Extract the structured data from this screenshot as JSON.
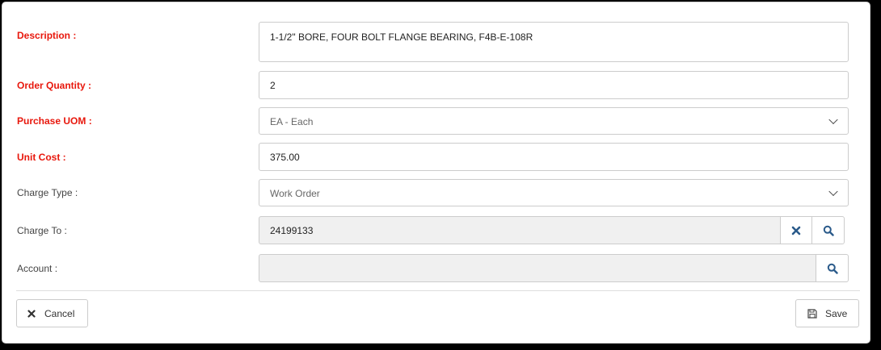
{
  "form": {
    "description": {
      "label": "Description :",
      "value": "1-1/2\" BORE, FOUR BOLT FLANGE BEARING, F4B-E-108R"
    },
    "order_quantity": {
      "label": "Order Quantity :",
      "value": "2"
    },
    "purchase_uom": {
      "label": "Purchase UOM :",
      "value": "EA - Each"
    },
    "unit_cost": {
      "label": "Unit Cost :",
      "value": "375.00"
    },
    "charge_type": {
      "label": "Charge Type :",
      "value": "Work Order"
    },
    "charge_to": {
      "label": "Charge To :",
      "value": "24199133"
    },
    "account": {
      "label": "Account :",
      "value": ""
    }
  },
  "actions": {
    "cancel_label": "Cancel",
    "save_label": "Save"
  },
  "icons": {
    "clear": "times-icon",
    "search": "search-icon",
    "cancel": "times-icon",
    "save": "floppy-disk-icon",
    "dropdown": "chevron-down-icon"
  },
  "colors": {
    "required_label": "#e8170c",
    "icon_accent": "#2a5a8a"
  }
}
